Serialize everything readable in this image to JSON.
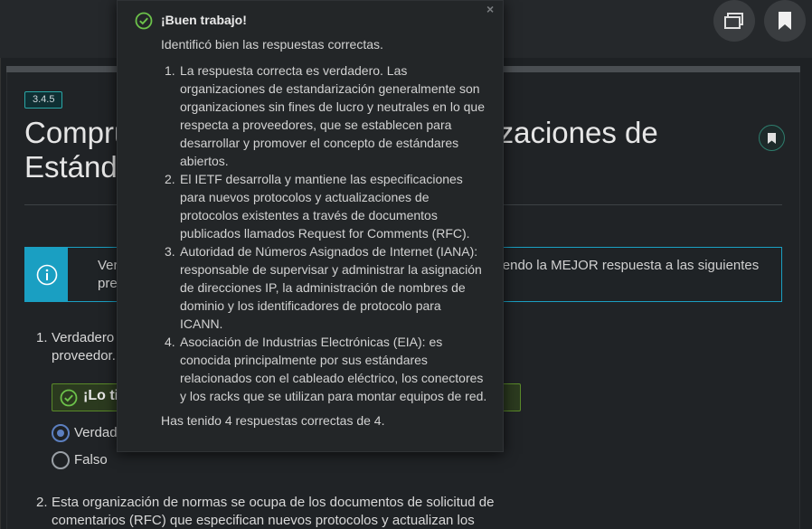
{
  "topbar": {
    "windows_icon": "windows-icon",
    "bookmark_icon": "bookmark-icon"
  },
  "section": {
    "tag": "3.4.5",
    "title_line1": "Comprueba su comprensión: organizaciones de",
    "title_line2": "Estándares"
  },
  "info": {
    "icon": "info-icon",
    "text": "Verifique su comprensión de las organizaciones de estándares eligiendo la MEJOR respuesta a las siguientes preguntas."
  },
  "questions": [
    {
      "number": "1.",
      "line1": "Verdadero o falso. Las organizaciones de estándares son",
      "line2": "proveedor.",
      "feedback": "¡Lo tienes!",
      "options": [
        {
          "label": "Verdadero",
          "selected": true
        },
        {
          "label": "Falso",
          "selected": false
        }
      ]
    },
    {
      "number": "2.",
      "line1": "Esta organización de normas se ocupa de los documentos de solicitud de",
      "line2": "comentarios (RFC) que especifican nuevos protocolos y actualizan los"
    }
  ],
  "popup": {
    "close": "×",
    "title": "¡Buen trabajo!",
    "intro": "Identificó bien las respuestas correctas.",
    "items": [
      {
        "num": "1.",
        "lines": [
          "La respuesta correcta es verdadero. Las",
          "organizaciones de estandarización generalmente son",
          "organizaciones sin fines de lucro y neutrales en lo que",
          "respecta a proveedores, que se establecen para",
          "desarrollar y promover el concepto de estándares",
          "abiertos."
        ]
      },
      {
        "num": "2.",
        "lines": [
          "El IETF desarrolla y mantiene las especificaciones",
          "para nuevos protocolos y actualizaciones de",
          "protocolos existentes a través de documentos",
          "publicados llamados Request for Comments (RFC)."
        ]
      },
      {
        "num": "3.",
        "lines": [
          "Autoridad de Números Asignados de Internet (IANA):",
          "responsable de supervisar y administrar la asignación",
          "de direcciones IP, la administración de nombres de",
          "dominio y los identificadores de protocolo para",
          "ICANN."
        ]
      },
      {
        "num": "4.",
        "lines": [
          "Asociación de Industrias Electrónicas (EIA): es",
          "conocida principalmente por sus estándares",
          "relacionados con el cableado eléctrico, los conectores",
          "y los racks que se utilizan para montar equipos de red."
        ]
      }
    ],
    "footer": "Has tenido 4 respuestas correctas de 4."
  },
  "colors": {
    "accent": "#1a9fc2",
    "success": "#5a8a2a",
    "check": "#6cc24a"
  }
}
